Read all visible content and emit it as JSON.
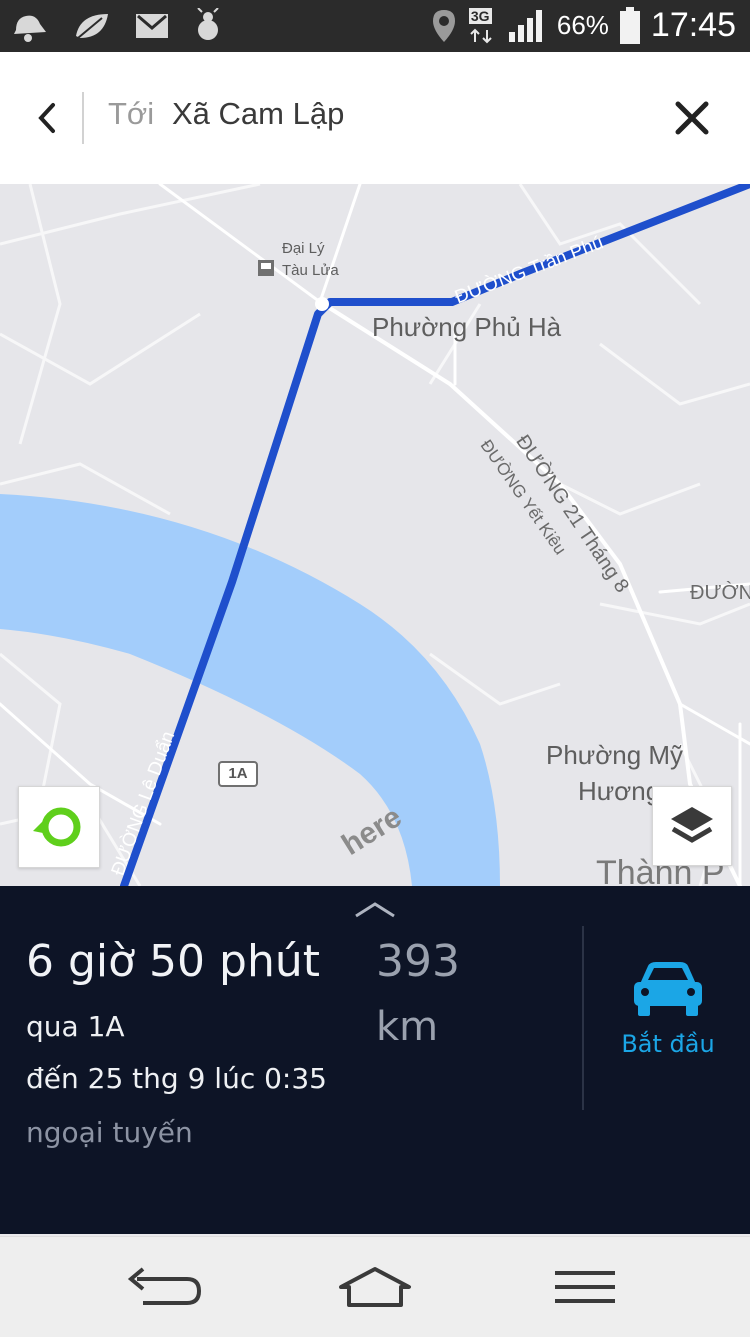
{
  "status_bar": {
    "battery": "66%",
    "network": "3G",
    "time": "17:45"
  },
  "top_bar": {
    "prefix": "Tới",
    "destination": "Xã Cam Lập"
  },
  "map": {
    "places": [
      "Đại Lý",
      "Tàu Lửa",
      "Phường Phủ Hà",
      "Phường Mỹ",
      "Hương",
      "Thành P"
    ],
    "roads": {
      "tran_phu": "ĐƯỜNG Trần Phú",
      "le_duan": "ĐƯỜNG Lê Duẩn",
      "thang8": "ĐƯỜNG 21 Tháng 8",
      "yet_kieu": "ĐƯỜNG Yết Kiêu",
      "partial": "ĐƯỜN"
    },
    "route_shield": "1A",
    "watermark": "here",
    "route_color": "#1f4fcc",
    "water_color": "#a3cdfb"
  },
  "route_panel": {
    "duration": "6 giờ 50 phút",
    "via": "qua 1A",
    "arrival": "đến 25 thg 9 lúc 0:35",
    "status": "ngoại tuyến",
    "distance_value": "393",
    "distance_unit": "km",
    "start_label": "Bắt đầu",
    "accent_color": "#1ba6e6"
  },
  "icons": {
    "back": "chevron-left-icon",
    "close": "close-icon",
    "locate": "my-location-icon",
    "layers": "layers-icon",
    "car": "car-icon",
    "expand": "chevron-up-icon"
  }
}
